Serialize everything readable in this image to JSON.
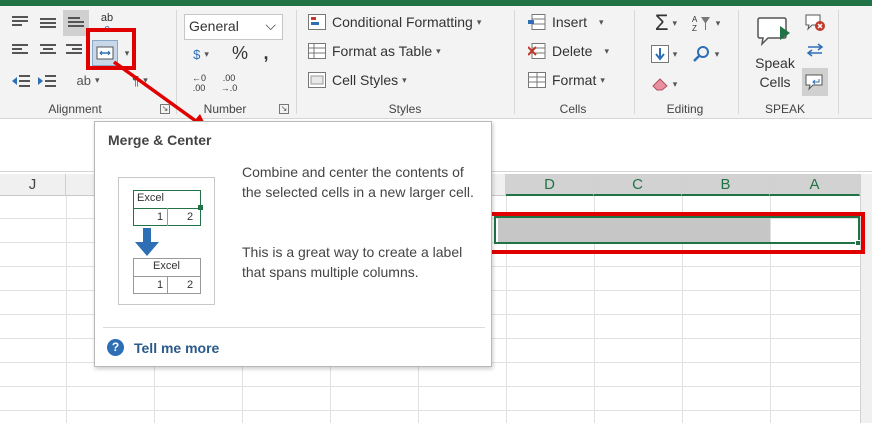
{
  "ribbon": {
    "alignment": {
      "label": "Alignment",
      "wrap_text_glyph": "ab",
      "wrap_text_glyph2": "c"
    },
    "number": {
      "label": "Number",
      "format_value": "General",
      "currency_symbol": "$",
      "percent_symbol": "%",
      "comma_symbol": ",",
      "increase_decimal_top": "←0",
      "increase_decimal_bottom": ".00",
      "decrease_decimal_top": ".00",
      "decrease_decimal_bottom": "→.0"
    },
    "styles": {
      "label": "Styles",
      "conditional_formatting": "Conditional Formatting",
      "format_as_table": "Format as Table",
      "cell_styles": "Cell Styles"
    },
    "cells": {
      "label": "Cells",
      "insert": "Insert",
      "delete": "Delete",
      "format": "Format"
    },
    "editing": {
      "label": "Editing",
      "sum_glyph": "Σ"
    },
    "speak": {
      "label": "SPEAK",
      "speak_cells_line1": "Speak",
      "speak_cells_line2": "Cells"
    }
  },
  "sheet": {
    "columns": [
      "J",
      "D",
      "C",
      "B",
      "A"
    ]
  },
  "tooltip": {
    "title": "Merge & Center",
    "description": "Combine and center the contents of the selected cells in a new larger cell.",
    "description2": "This is a great way to create a label that spans multiple columns.",
    "illustration": {
      "top_label": "Excel",
      "top_num1": "1",
      "top_num2": "2",
      "bottom_label": "Excel",
      "bottom_num1": "1",
      "bottom_num2": "2"
    },
    "help_glyph": "?",
    "tell_me_more": "Tell me more"
  },
  "colors": {
    "excel_green": "#217346",
    "highlight_red": "#e00000",
    "help_blue": "#2e6eb5"
  }
}
